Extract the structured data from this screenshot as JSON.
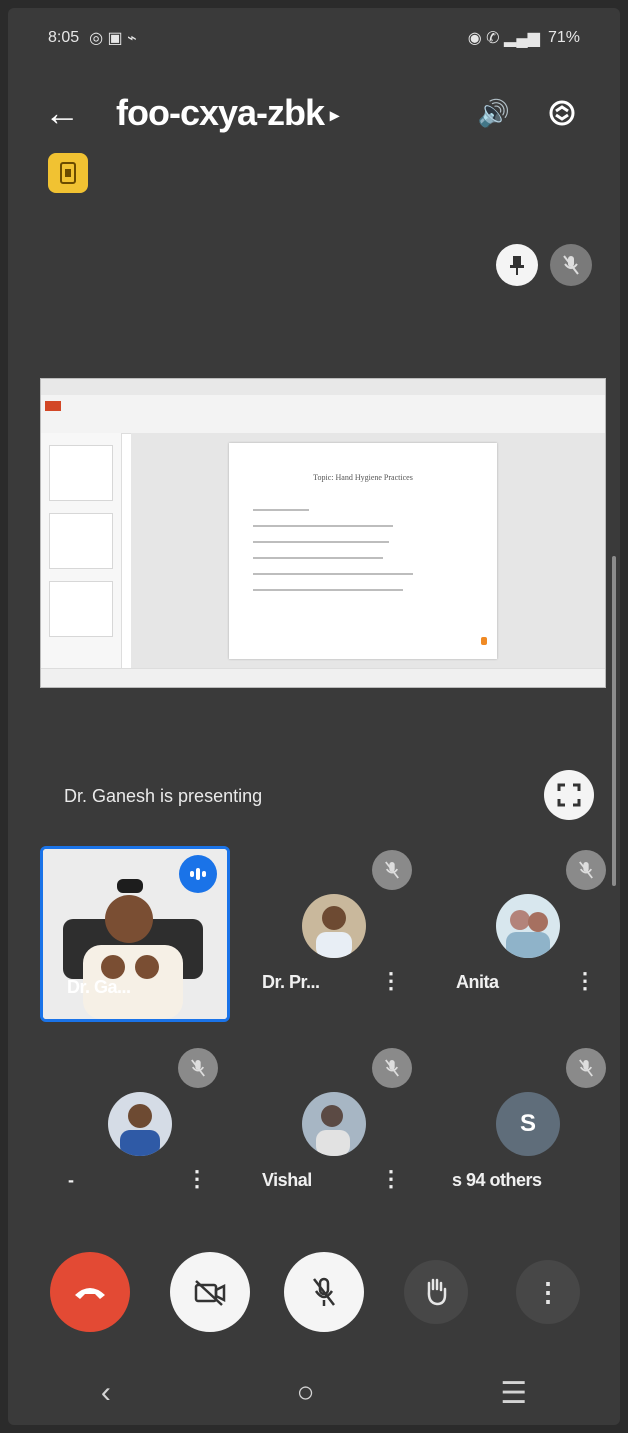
{
  "status_bar": {
    "time": "8:05",
    "battery": "71%"
  },
  "meeting": {
    "code": "foo-cxya-zbk",
    "caret": "▸"
  },
  "presentation": {
    "presenting_text": "Dr. Ganesh is presenting",
    "slide_title": "Topic: Hand Hygiene Practices"
  },
  "participants": [
    {
      "id": "main",
      "name": "Dr. Ga...",
      "speaking": true
    },
    {
      "id": "p2",
      "name": "Dr. Pr...",
      "muted": true
    },
    {
      "id": "p3",
      "name": "Anita",
      "muted": true
    },
    {
      "id": "p4",
      "name": "-",
      "muted": true
    },
    {
      "id": "p5",
      "name": "Vishal",
      "muted": true
    },
    {
      "id": "p6",
      "initial": "S",
      "name": "s 94 others",
      "muted": true
    }
  ],
  "controls": {
    "more": "⋮"
  },
  "nav": {
    "back": "‹",
    "home": "○",
    "recents": "☰"
  }
}
